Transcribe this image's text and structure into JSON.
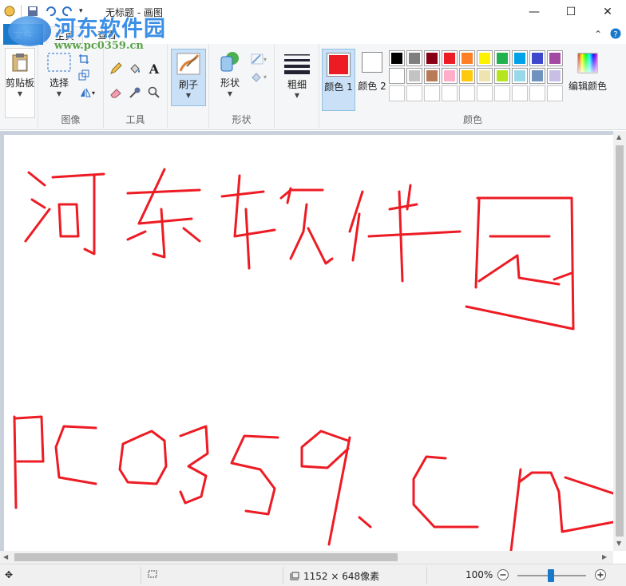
{
  "window": {
    "title": "无标题 - 画图",
    "minimize_glyph": "—",
    "maximize_glyph": "☐",
    "close_glyph": "✕"
  },
  "watermark": {
    "text": "河东软件园",
    "url": "www.pc0359.cn"
  },
  "tabs": {
    "file": "文件",
    "home": "主页",
    "view": "查看"
  },
  "ribbon": {
    "clipboard": {
      "label": "剪贴板"
    },
    "image": {
      "group_label": "图像",
      "select_label": "选择"
    },
    "tools": {
      "group_label": "工具"
    },
    "brushes": {
      "label": "刷子"
    },
    "shapes": {
      "label": "形状",
      "group_label": "形状"
    },
    "size": {
      "label": "粗细"
    },
    "colors": {
      "group_label": "颜色",
      "color1_label": "颜色 1",
      "color2_label": "颜色 2",
      "edit_label": "编辑颜色",
      "color1": "#ed1c24",
      "color2": "#ffffff",
      "palette": [
        "#000000",
        "#7f7f7f",
        "#880015",
        "#ed1c24",
        "#ff7f27",
        "#fff200",
        "#22b14c",
        "#00a2e8",
        "#3f48cc",
        "#a349a4",
        "#ffffff",
        "#c3c3c3",
        "#b97a57",
        "#ffaec9",
        "#ffc90e",
        "#efe4b0",
        "#b5e61d",
        "#99d9ea",
        "#7092be",
        "#c8bfe7",
        "",
        "",
        "",
        "",
        "",
        "",
        "",
        "",
        "",
        ""
      ]
    }
  },
  "canvas": {
    "drawing_color": "#ed1c24"
  },
  "status": {
    "dimensions": "1152 × 648像素",
    "zoom": "100%"
  }
}
